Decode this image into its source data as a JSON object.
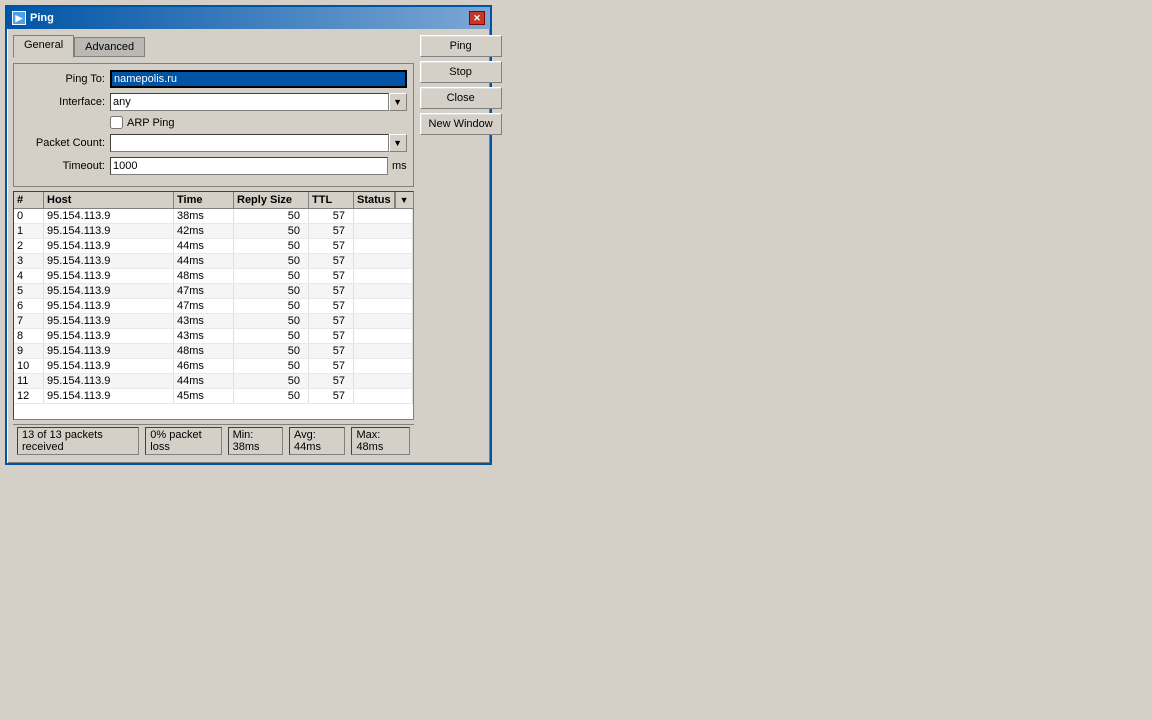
{
  "window": {
    "title": "Ping",
    "icon": "▶"
  },
  "tabs": [
    {
      "label": "General",
      "active": true
    },
    {
      "label": "Advanced",
      "active": false
    }
  ],
  "form": {
    "ping_to_label": "Ping To:",
    "ping_to_value": "namepolis.ru",
    "interface_label": "Interface:",
    "interface_value": "any",
    "arp_ping_label": "ARP Ping",
    "packet_count_label": "Packet Count:",
    "packet_count_value": "",
    "timeout_label": "Timeout:",
    "timeout_value": "1000",
    "timeout_unit": "ms"
  },
  "buttons": {
    "ping": "Ping",
    "stop": "Stop",
    "close": "Close",
    "new_window": "New Window"
  },
  "table": {
    "columns": [
      "#",
      "Host",
      "Time",
      "Reply Size",
      "TTL",
      "Status"
    ],
    "rows": [
      {
        "num": "0",
        "host": "95.154.113.9",
        "time": "38ms",
        "reply_size": "50",
        "ttl": "57",
        "status": ""
      },
      {
        "num": "1",
        "host": "95.154.113.9",
        "time": "42ms",
        "reply_size": "50",
        "ttl": "57",
        "status": ""
      },
      {
        "num": "2",
        "host": "95.154.113.9",
        "time": "44ms",
        "reply_size": "50",
        "ttl": "57",
        "status": ""
      },
      {
        "num": "3",
        "host": "95.154.113.9",
        "time": "44ms",
        "reply_size": "50",
        "ttl": "57",
        "status": ""
      },
      {
        "num": "4",
        "host": "95.154.113.9",
        "time": "48ms",
        "reply_size": "50",
        "ttl": "57",
        "status": ""
      },
      {
        "num": "5",
        "host": "95.154.113.9",
        "time": "47ms",
        "reply_size": "50",
        "ttl": "57",
        "status": ""
      },
      {
        "num": "6",
        "host": "95.154.113.9",
        "time": "47ms",
        "reply_size": "50",
        "ttl": "57",
        "status": ""
      },
      {
        "num": "7",
        "host": "95.154.113.9",
        "time": "43ms",
        "reply_size": "50",
        "ttl": "57",
        "status": ""
      },
      {
        "num": "8",
        "host": "95.154.113.9",
        "time": "43ms",
        "reply_size": "50",
        "ttl": "57",
        "status": ""
      },
      {
        "num": "9",
        "host": "95.154.113.9",
        "time": "48ms",
        "reply_size": "50",
        "ttl": "57",
        "status": ""
      },
      {
        "num": "10",
        "host": "95.154.113.9",
        "time": "46ms",
        "reply_size": "50",
        "ttl": "57",
        "status": ""
      },
      {
        "num": "11",
        "host": "95.154.113.9",
        "time": "44ms",
        "reply_size": "50",
        "ttl": "57",
        "status": ""
      },
      {
        "num": "12",
        "host": "95.154.113.9",
        "time": "45ms",
        "reply_size": "50",
        "ttl": "57",
        "status": ""
      }
    ]
  },
  "status_bar": {
    "packets": "13 of 13 packets received",
    "loss": "0% packet loss",
    "min": "Min: 38ms",
    "avg": "Avg: 44ms",
    "max": "Max: 48ms"
  }
}
